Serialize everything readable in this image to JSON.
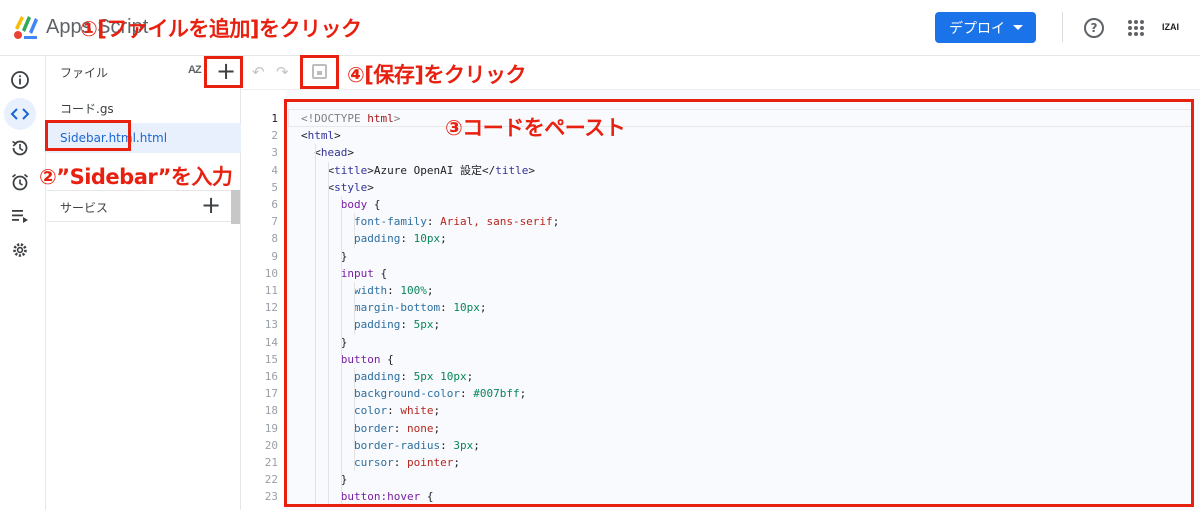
{
  "app": {
    "title": "Apps Script"
  },
  "topbar": {
    "deploy_label": "デプロイ",
    "help_icon": "help-circle-icon",
    "apps_icon": "apps-grid-icon",
    "brand_badge": "IZAI"
  },
  "rail": {
    "items": [
      {
        "icon": "info-icon"
      },
      {
        "icon": "code-icon",
        "active": true
      },
      {
        "icon": "history-icon"
      },
      {
        "icon": "alarm-icon"
      },
      {
        "icon": "executions-icon"
      },
      {
        "icon": "settings-icon"
      }
    ]
  },
  "files": {
    "title": "ファイル",
    "sort_label": "AZ",
    "add_label": "+",
    "items": [
      {
        "label": "コード.gs"
      },
      {
        "label": "Sidebar.html.html",
        "selected": true
      }
    ],
    "services_title": "サービス",
    "services_add_label": "+"
  },
  "toolbar": {
    "undo_icon": "↶",
    "redo_icon": "↷",
    "save_icon": "save-icon"
  },
  "editor": {
    "current_line": 1,
    "lines": [
      "<!DOCTYPE html>",
      "<html>",
      "  <head>",
      "    <title>Azure OpenAI 設定</title>",
      "    <style>",
      "      body {",
      "        font-family: Arial, sans-serif;",
      "        padding: 10px;",
      "      }",
      "      input {",
      "        width: 100%;",
      "        margin-bottom: 10px;",
      "        padding: 5px;",
      "      }",
      "      button {",
      "        padding: 5px 10px;",
      "        background-color: #007bff;",
      "        color: white;",
      "        border: none;",
      "        border-radius: 3px;",
      "        cursor: pointer;",
      "      }",
      "      button:hover {"
    ]
  },
  "annotations": {
    "step1": "①[ファイルを追加]をクリック",
    "step2": "②”Sidebar”を入力",
    "step3": "③コードをペースト",
    "step4": "④[保存]をクリック",
    "color": "#e8200f"
  }
}
